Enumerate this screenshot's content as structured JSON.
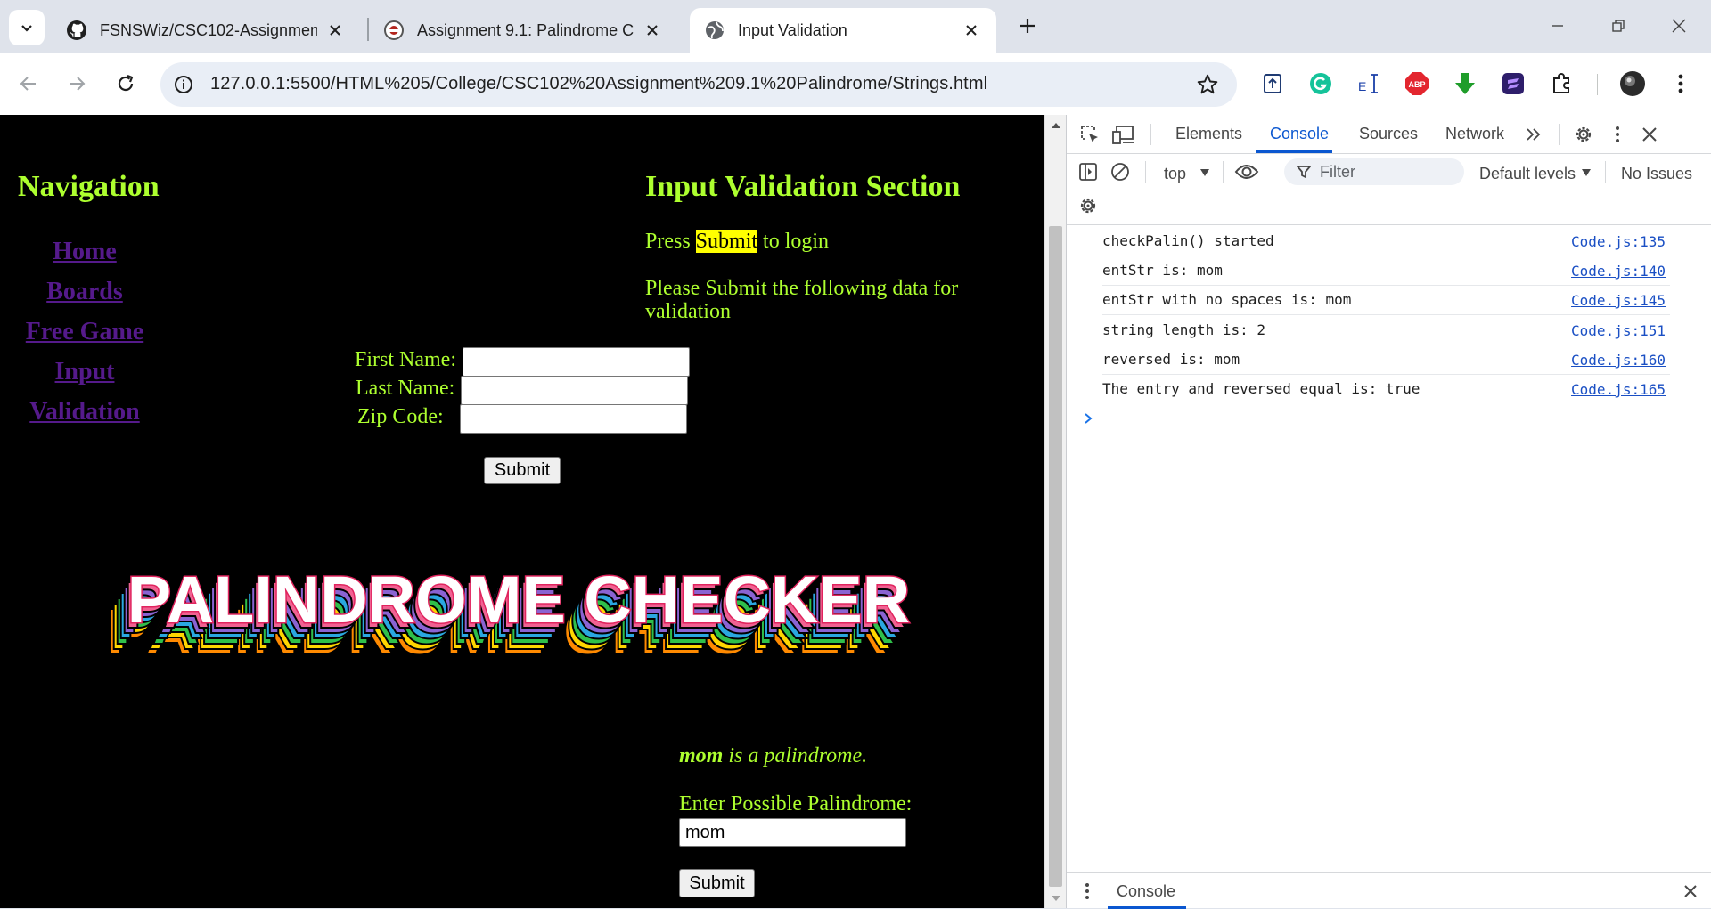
{
  "tabs": [
    {
      "title": "FSNSWiz/CSC102-Assignment-",
      "favicon": "github-icon"
    },
    {
      "title": "Assignment 9.1: Palindrome Ch",
      "favicon": "school-icon"
    },
    {
      "title": "Input Validation",
      "favicon": "globe-icon"
    }
  ],
  "address": {
    "url": "127.0.0.1:5500/HTML%205/College/CSC102%20Assignment%209.1%20Palindrome/Strings.html"
  },
  "page": {
    "nav_heading": "Navigation",
    "nav_links": [
      "Home",
      "Boards",
      "Free Game",
      "Input",
      "Validation"
    ],
    "section_heading": "Input Validation Section",
    "press_prefix": "Press ",
    "press_highlight": "Submit",
    "press_suffix": " to login",
    "please_text": "Please Submit the following data for validation",
    "form": {
      "first_name_label": "First Name:",
      "last_name_label": "Last Name:",
      "zip_label": "Zip Code:",
      "first_name_value": "",
      "last_name_value": "",
      "zip_value": "",
      "submit_label": "Submit"
    },
    "banner_text": "PALINDROME CHECKER",
    "result_word": "mom",
    "result_rest": " is a palindrome.",
    "enter_label": "Enter Possible Palindrome:",
    "palindrome_value": "mom",
    "palindrome_submit": "Submit"
  },
  "devtools": {
    "tabs": [
      "Elements",
      "Console",
      "Sources",
      "Network"
    ],
    "active_tab": "Console",
    "context": "top",
    "filter_placeholder": "Filter",
    "levels": "Default levels",
    "issues": "No Issues",
    "logs": [
      {
        "msg": "checkPalin() started",
        "src": "Code.js:135"
      },
      {
        "msg": "entStr is: mom",
        "src": "Code.js:140"
      },
      {
        "msg": "entStr with no spaces is: mom",
        "src": "Code.js:145"
      },
      {
        "msg": "string length is: 2",
        "src": "Code.js:151"
      },
      {
        "msg": "reversed is: mom",
        "src": "Code.js:160"
      },
      {
        "msg": "The entry and reversed equal is: true",
        "src": "Code.js:165"
      }
    ],
    "drawer_tab": "Console"
  },
  "colors": {
    "accent_green": "#adff2f",
    "visited_link": "#551a8b",
    "devtools_blue": "#0b57d0"
  }
}
